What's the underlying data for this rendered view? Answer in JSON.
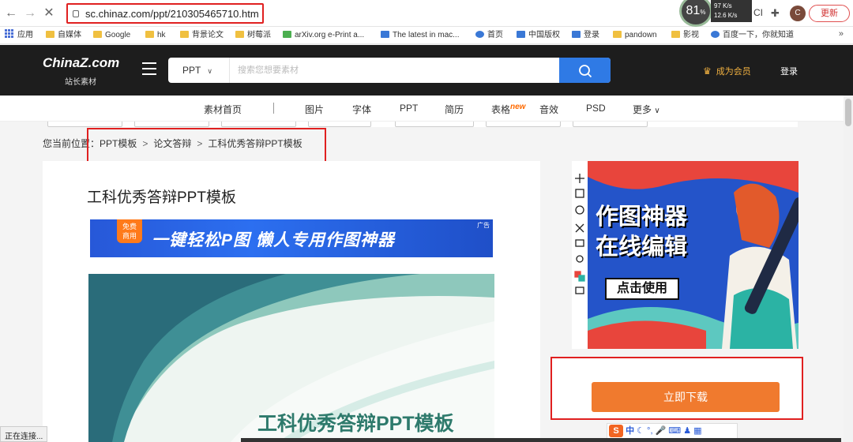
{
  "browser": {
    "url": "sc.chinaz.com/ppt/210305465710.htm",
    "network": {
      "percent": "81",
      "percent_unit": "%",
      "up": "97 K/s",
      "down": "12.6 K/s"
    },
    "ext_label": "CI",
    "avatar_letter": "C",
    "update_label": "更新",
    "bookmarks": [
      {
        "label": "应用",
        "icon": "apps-grid-icon"
      },
      {
        "label": "自媒体",
        "icon": "folder-icon"
      },
      {
        "label": "Google",
        "icon": "folder-icon"
      },
      {
        "label": "hk",
        "icon": "folder-icon"
      },
      {
        "label": "背景论文",
        "icon": "folder-icon"
      },
      {
        "label": "树莓派",
        "icon": "folder-icon"
      },
      {
        "label": "arXiv.org e-Print a...",
        "icon": "arxiv-icon"
      },
      {
        "label": "The latest in mac...",
        "icon": "paperswithcode-icon"
      },
      {
        "label": "首页",
        "icon": "site-icon"
      },
      {
        "label": "中国版权",
        "icon": "site-icon"
      },
      {
        "label": "登录",
        "icon": "site-icon"
      },
      {
        "label": "pandown",
        "icon": "folder-icon"
      },
      {
        "label": "影视",
        "icon": "folder-icon"
      },
      {
        "label": "百度一下，你就知道",
        "icon": "baidu-icon"
      }
    ],
    "more": "»",
    "status_text": "正在连接..."
  },
  "header": {
    "logo": "ChinaZ.com",
    "logo_sub": "站长素材",
    "search_category": "PPT",
    "search_placeholder": "搜索您想要素材",
    "vip_label": "成为会员",
    "login_label": "登录"
  },
  "catnav": {
    "items": [
      "素材首页",
      "图片",
      "字体",
      "PPT",
      "简历",
      "表格",
      "音效",
      "PSD",
      "更多"
    ],
    "new_tag": "new"
  },
  "breadcrumb": {
    "prefix": "您当前位置：",
    "items": [
      "PPT模板",
      "论文答辩",
      "工科优秀答辩PPT模板"
    ],
    "separator": ">"
  },
  "main": {
    "title": "工科优秀答辩PPT模板",
    "ad": {
      "badge_line1": "免费",
      "badge_line2": "商用",
      "text": "一键轻松P图  懒人专用作图神器",
      "mark": "广告"
    },
    "preview_title": "工科优秀答辩PPT模板"
  },
  "sidebar": {
    "headline_line1": "作图神器",
    "headline_line2": "在线编辑",
    "cta": "点击使用",
    "download_label": "立即下载"
  },
  "ime": {
    "logo": "S",
    "mode": "中"
  },
  "colors": {
    "accent_blue": "#2f7ae5",
    "download_orange": "#f07a2e",
    "highlight_red": "#e02020",
    "header_dark": "#1d1d1d"
  }
}
